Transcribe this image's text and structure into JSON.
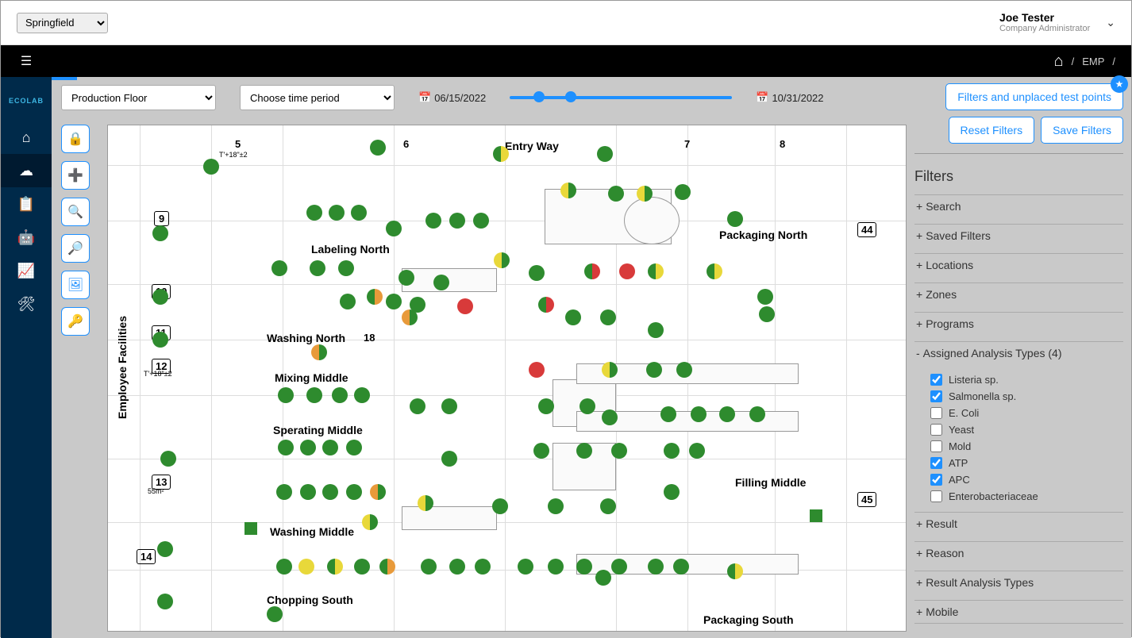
{
  "topbar": {
    "location": "Springfield",
    "user_name": "Joe Tester",
    "user_role": "Company Administrator"
  },
  "breadcrumb": {
    "item1": "EMP"
  },
  "sidebar": {
    "logo": "ECOLAB"
  },
  "controls": {
    "floor": "Production Floor",
    "period": "Choose time period",
    "date_start": "06/15/2022",
    "date_end": "10/31/2022"
  },
  "floorplan": {
    "labels": {
      "entry": "Entry Way",
      "pack_north": "Packaging North",
      "label_north": "Labeling North",
      "wash_north": "Washing North",
      "mix_mid": "Mixing Middle",
      "sep_mid": "Sperating Middle",
      "wash_mid": "Washing Middle",
      "chop_south": "Chopping South",
      "fill_mid": "Filling Middle",
      "pack_south": "Packaging South",
      "emp_fac": "Employee Facilities",
      "n5": "5",
      "n6": "6",
      "n7": "7",
      "n8": "8",
      "n9": "9",
      "n10": "10",
      "n11": "11",
      "n12": "12",
      "n13": "13",
      "n14": "14",
      "n18": "18",
      "n44": "44",
      "n45": "45",
      "dim1": "T'+18\"±2",
      "dim2": "T'+18\"±2",
      "dim3": "55m²"
    }
  },
  "right": {
    "filters_btn": "Filters and unplaced test points",
    "reset": "Reset Filters",
    "save": "Save Filters",
    "filters_title": "Filters",
    "sections": {
      "search": "Search",
      "saved": "Saved Filters",
      "locations": "Locations",
      "zones": "Zones",
      "programs": "Programs",
      "assigned": "Assigned Analysis Types (4)",
      "result": "Result",
      "reason": "Reason",
      "result_types": "Result Analysis Types",
      "mobile": "Mobile"
    },
    "analysis": {
      "listeria": "Listeria sp.",
      "salmonella": "Salmonella sp.",
      "ecoli": "E. Coli",
      "yeast": "Yeast",
      "mold": "Mold",
      "atp": "ATP",
      "apc": "APC",
      "entero": "Enterobacteriaceae"
    }
  }
}
